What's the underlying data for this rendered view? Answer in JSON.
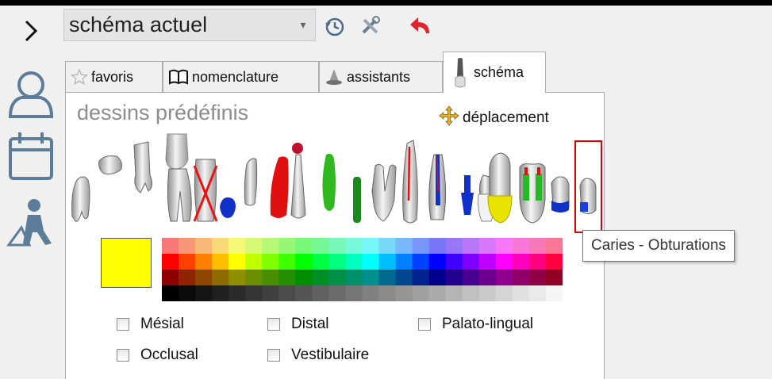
{
  "toolbar": {
    "schema_select": "schéma actuel",
    "icons": [
      "history-icon",
      "tools-icon",
      "undo-icon"
    ]
  },
  "sidebar": {
    "icons": [
      "chevron-right-icon",
      "user-icon",
      "calendar-icon",
      "worker-icon"
    ]
  },
  "tabs": [
    {
      "label": "favoris",
      "icon": "star-icon"
    },
    {
      "label": "nomenclature",
      "icon": "book-icon"
    },
    {
      "label": "assistants",
      "icon": "wizard-icon"
    },
    {
      "label": "schéma",
      "icon": "tooth-icon",
      "active": true
    }
  ],
  "panel": {
    "title": "dessins prédéfinis",
    "move_label": "déplacement",
    "tooth_drawings_selected": 21
  },
  "color": {
    "selected": "#ffff00"
  },
  "checkboxes": {
    "mesial": "Mésial",
    "distal": "Distal",
    "palato": "Palato-lingual",
    "occlusal": "Occlusal",
    "vestibulaire": "Vestibulaire"
  },
  "tooltip": {
    "text": "Caries - Obturations"
  }
}
